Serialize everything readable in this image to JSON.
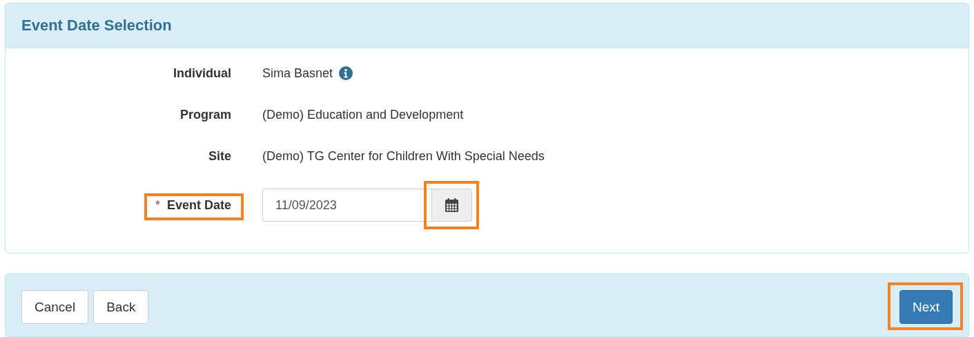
{
  "panel": {
    "title": "Event Date Selection"
  },
  "fields": [
    {
      "label": "Individual",
      "kind": "text",
      "value": "Sima Basnet",
      "info": true,
      "highlighted": false
    },
    {
      "label": "Program",
      "kind": "text",
      "value": "(Demo) Education and Development",
      "info": false,
      "highlighted": false
    },
    {
      "label": "Site",
      "kind": "text",
      "value": "(Demo) TG Center for Children With Special Needs",
      "info": false,
      "highlighted": false
    },
    {
      "label": "Event Date",
      "kind": "date",
      "required_mark": "*",
      "value": "11/09/2023",
      "highlighted": true,
      "picker_highlighted": true
    }
  ],
  "actions": [
    {
      "label": "Cancel",
      "kind": "default",
      "highlighted": false
    },
    {
      "label": "Back",
      "kind": "default",
      "highlighted": false
    },
    {
      "label": "Next",
      "kind": "primary",
      "highlighted": true
    }
  ]
}
